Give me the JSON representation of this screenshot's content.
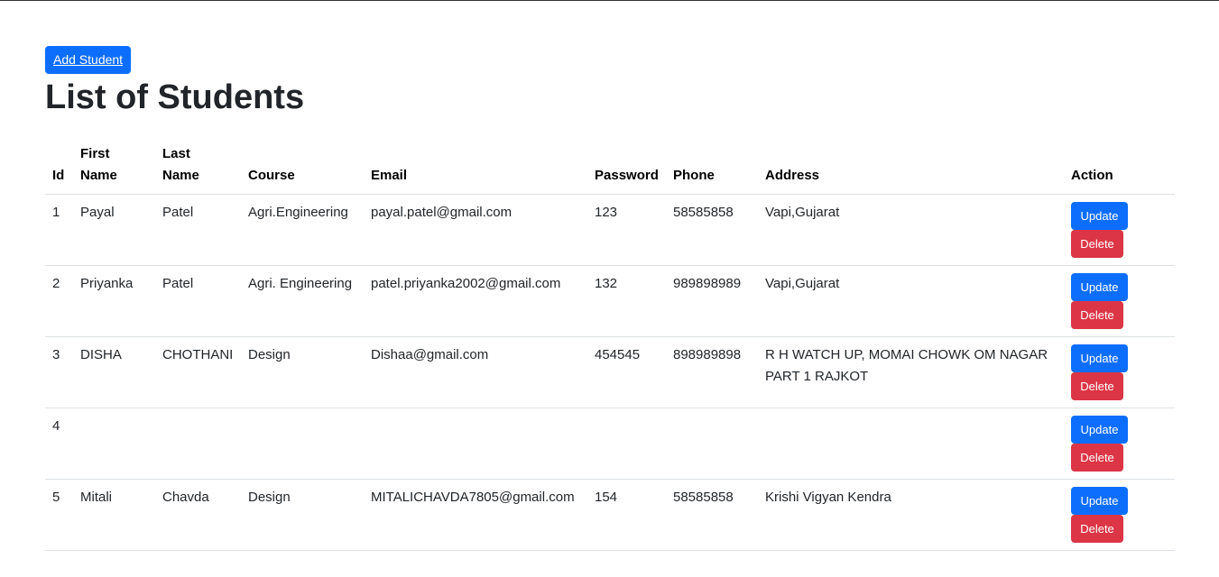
{
  "page": {
    "add_button_label": "Add Student",
    "title": "List of Students"
  },
  "table": {
    "headers": {
      "id": "Id",
      "first_name_1": "First",
      "first_name_2": "Name",
      "last_name_1": "Last",
      "last_name_2": "Name",
      "course": "Course",
      "email": "Email",
      "password": "Password",
      "phone": "Phone",
      "address": "Address",
      "action": "Action"
    },
    "update_label": "Update",
    "delete_label": "Delete",
    "rows": [
      {
        "id": "1",
        "first": "Payal",
        "last": "Patel",
        "course": "Agri.Engineering",
        "email": "payal.patel@gmail.com",
        "password": "123",
        "phone": "58585858",
        "address": "Vapi,Gujarat"
      },
      {
        "id": "2",
        "first": "Priyanka",
        "last": "Patel",
        "course": "Agri. Engineering",
        "email": "patel.priyanka2002@gmail.com",
        "password": "132",
        "phone": "989898989",
        "address": "Vapi,Gujarat"
      },
      {
        "id": "3",
        "first": "DISHA",
        "last": "CHOTHANI",
        "course": "Design",
        "email": "Dishaa@gmail.com",
        "password": "454545",
        "phone": "898989898",
        "address": "R H WATCH UP, MOMAI CHOWK OM NAGAR PART 1 RAJKOT"
      },
      {
        "id": "4",
        "first": "",
        "last": "",
        "course": "",
        "email": "",
        "password": "",
        "phone": "",
        "address": ""
      },
      {
        "id": "5",
        "first": "Mitali",
        "last": "Chavda",
        "course": "Design",
        "email": "MITALICHAVDA7805@gmail.com",
        "password": "154",
        "phone": "58585858",
        "address": "Krishi Vigyan Kendra"
      }
    ]
  }
}
